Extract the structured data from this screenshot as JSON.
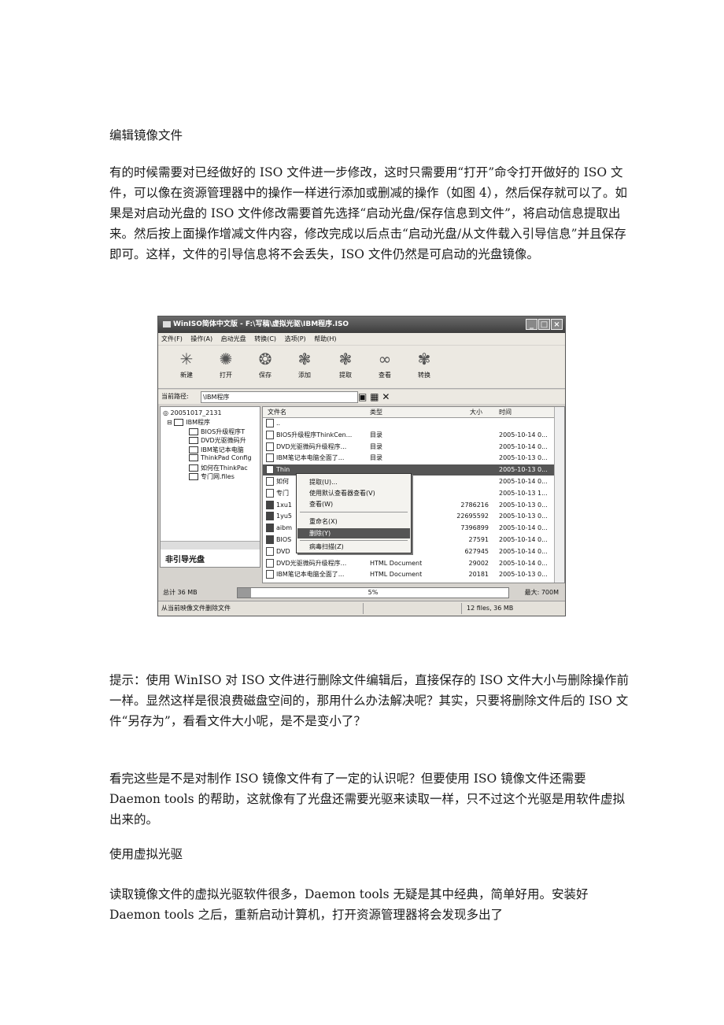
{
  "heading1": "编辑镜像文件",
  "para1": "有的时候需要对已经做好的 ISO 文件进一步修改，这时只需要用“打开”命令打开做好的 ISO 文件，可以像在资源管理器中的操作一样进行添加或删减的操作（如图 4），然后保存就可以了。如果是对启动光盘的 ISO 文件修改需要首先选择“启动光盘/保存信息到文件”，将启动信息提取出来。然后按上面操作增减文件内容，修改完成以后点击“启动光盘/从文件载入引导信息”并且保存即可。这样，文件的引导信息将不会丢失，ISO 文件仍然是可启动的光盘镜像。",
  "window": {
    "title": "WinISO简体中文版 - F:\\写稿\\虚拟光驱\\IBM程序.ISO",
    "menus": [
      "文件(F)",
      "操作(A)",
      "启动光盘",
      "转换(C)",
      "选项(P)",
      "帮助(H)"
    ],
    "tools": [
      "新建",
      "打开",
      "保存",
      "添加",
      "提取",
      "查看",
      "转换"
    ],
    "path_label": "当前路径:",
    "path_value": "\\IBM程序",
    "tree": [
      "20051017_2131",
      "IBM程序",
      "BIOS升级程序T",
      "DVD光驱微码升",
      "IBM笔记本电脑",
      "ThinkPad Config",
      "如何在ThinkPac",
      "专门网.files"
    ],
    "tree_footer": "非引导光盘",
    "columns": [
      "文件名",
      "类型",
      "大小",
      "时间"
    ],
    "rows": [
      {
        "name": "..",
        "type": "",
        "size": "",
        "time": ""
      },
      {
        "name": "BIOS升级程序ThinkCen...",
        "type": "目录",
        "size": "",
        "time": "2005-10-14 0..."
      },
      {
        "name": "DVD光驱微码升级程序...",
        "type": "目录",
        "size": "",
        "time": "2005-10-14 0..."
      },
      {
        "name": "IBM笔记本电脑全面了...",
        "type": "目录",
        "size": "",
        "time": "2005-10-13 0..."
      },
      {
        "name": "Thin",
        "type": "",
        "size": "",
        "time": "2005-10-13 0..."
      },
      {
        "name": "如何",
        "type": "",
        "size": "",
        "time": "2005-10-14 0..."
      },
      {
        "name": "专门",
        "type": "",
        "size": "",
        "time": "2005-10-13 1..."
      },
      {
        "name": "1xu1",
        "type": "",
        "size": "2786216",
        "time": "2005-10-13 0..."
      },
      {
        "name": "1yu5",
        "type": "",
        "size": "22695592",
        "time": "2005-10-13 0..."
      },
      {
        "name": "aibm",
        "type": "",
        "size": "7396899",
        "time": "2005-10-14 0..."
      },
      {
        "name": "BIOS",
        "type": "",
        "size": "27591",
        "time": "2005-10-14 0..."
      },
      {
        "name": "DVD",
        "type": "",
        "size": "627945",
        "time": "2005-10-14 0..."
      },
      {
        "name": "DVD光驱微码升级程序...",
        "type": "HTML Document",
        "size": "29002",
        "time": "2005-10-14 0..."
      },
      {
        "name": "IBM笔记本电脑全面了...",
        "type": "HTML Document",
        "size": "20181",
        "time": "2005-10-13 0..."
      }
    ],
    "context_menu": [
      "提取(U)...",
      "使用默认查看器查看(V)",
      "查看(W)",
      "重命名(X)",
      "删除(Y)",
      "病毒扫描(Z)"
    ],
    "total_label": "总计 36 MB",
    "progress_percent": 5,
    "progress_label": "5%",
    "max_label": "最大: 700M",
    "status_left": "从当前映像文件删除文件",
    "status_right": "12 files, 36 MB"
  },
  "para2": "提示：使用 WinISO 对 ISO 文件进行删除文件编辑后，直接保存的 ISO 文件大小与删除操作前一样。显然这样是很浪费磁盘空间的，那用什么办法解决呢？其实，只要将删除文件后的 ISO 文件“另存为”，看看文件大小呢，是不是变小了？",
  "para3": "看完这些是不是对制作 ISO 镜像文件有了一定的认识呢？但要使用 ISO 镜像文件还需要 Daemon tools 的帮助，这就像有了光盘还需要光驱来读取一样，只不过这个光驱是用软件虚拟出来的。",
  "heading2": "使用虚拟光驱",
  "para4": "读取镜像文件的虚拟光驱软件很多，Daemon tools 无疑是其中经典，简单好用。安装好 Daemon tools 之后，重新启动计算机，打开资源管理器将会发现多出了"
}
